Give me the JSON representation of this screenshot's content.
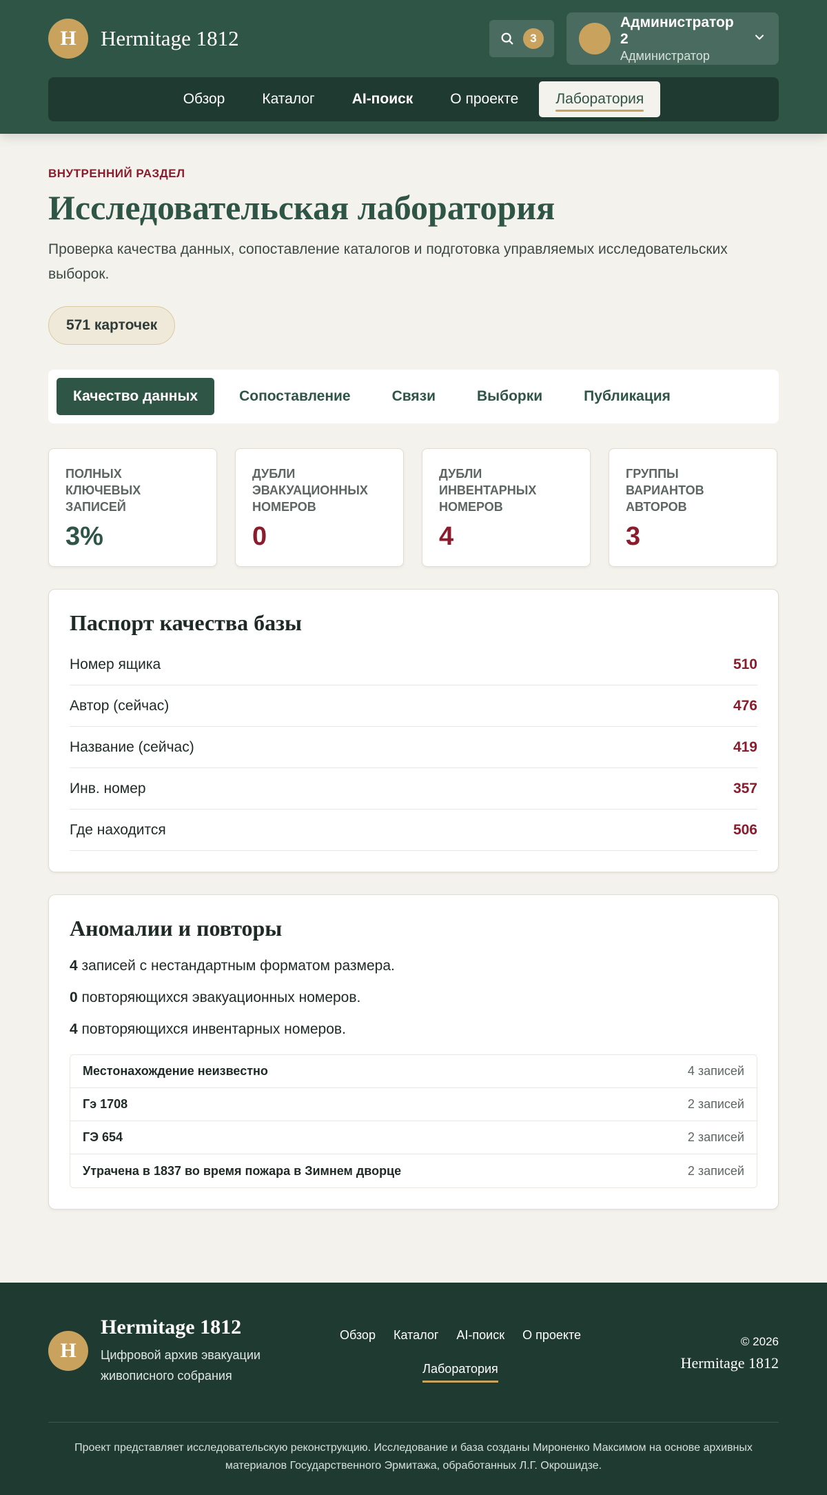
{
  "header": {
    "logo_letter": "H",
    "brand": "Hermitage 1812",
    "search_count": "3",
    "user_name": "Администратор 2",
    "user_role": "Администратор"
  },
  "nav": [
    {
      "label": "Обзор",
      "bold": false,
      "active": false
    },
    {
      "label": "Каталог",
      "bold": false,
      "active": false
    },
    {
      "label": "AI-поиск",
      "bold": true,
      "active": false
    },
    {
      "label": "О проекте",
      "bold": false,
      "active": false
    },
    {
      "label": "Лаборатория",
      "bold": false,
      "active": true
    }
  ],
  "page": {
    "eyebrow": "ВНУТРЕННИЙ РАЗДЕЛ",
    "title": "Исследовательская лаборатория",
    "description": "Проверка качества данных, сопоставление каталогов и подготовка управляемых исследовательских выборок.",
    "cards_count": "571 карточек"
  },
  "tabs": [
    {
      "label": "Качество данных",
      "active": true
    },
    {
      "label": "Сопоставление",
      "active": false
    },
    {
      "label": "Связи",
      "active": false
    },
    {
      "label": "Выборки",
      "active": false
    },
    {
      "label": "Публикация",
      "active": false
    }
  ],
  "stats": [
    {
      "label": "Полных ключевых записей",
      "value": "3%",
      "tone": "green"
    },
    {
      "label": "Дубли эвакуационных номеров",
      "value": "0",
      "tone": "red"
    },
    {
      "label": "Дубли инвентарных номеров",
      "value": "4",
      "tone": "red"
    },
    {
      "label": "Группы вариантов авторов",
      "value": "3",
      "tone": "red"
    }
  ],
  "quality": {
    "title": "Паспорт качества базы",
    "rows": [
      {
        "label": "Номер ящика",
        "value": "510"
      },
      {
        "label": "Автор (сейчас)",
        "value": "476"
      },
      {
        "label": "Название (сейчас)",
        "value": "419"
      },
      {
        "label": "Инв. номер",
        "value": "357"
      },
      {
        "label": "Где находится",
        "value": "506"
      }
    ]
  },
  "anomalies": {
    "title": "Аномалии и повторы",
    "lines": [
      {
        "num": "4",
        "text": " записей с нестандартным форматом размера."
      },
      {
        "num": "0",
        "text": " повторяющихся эвакуационных номеров."
      },
      {
        "num": "4",
        "text": " повторяющихся инвентарных номеров."
      }
    ],
    "rows": [
      {
        "name": "Местонахождение неизвестно",
        "count": "4 записей"
      },
      {
        "name": "Гэ 1708",
        "count": "2 записей"
      },
      {
        "name": "ГЭ 654",
        "count": "2 записей"
      },
      {
        "name": "Утрачена в 1837 во время пожара в Зимнем дворце",
        "count": "2 записей"
      }
    ]
  },
  "footer": {
    "logo_letter": "H",
    "brand": "Hermitage 1812",
    "tagline": "Цифровой архив эвакуации живописного собрания",
    "nav": [
      {
        "label": "Обзор",
        "active": false
      },
      {
        "label": "Каталог",
        "active": false
      },
      {
        "label": "AI-поиск",
        "active": false
      },
      {
        "label": "О проекте",
        "active": false
      },
      {
        "label": "Лаборатория",
        "active": true
      }
    ],
    "copyright": "© 2026",
    "right_name": "Hermitage 1812",
    "note": "Проект представляет исследовательскую реконструкцию. Исследование и база созданы Мироненко Максимом на основе архивных материалов Государственного Эрмитажа, обработанных Л.Г. Окрошидзе."
  },
  "colors": {
    "primary": "#2f5547",
    "dark": "#1f3a31",
    "accent": "#c9a35d",
    "danger": "#8a1c2e",
    "background": "#f4f2ec"
  },
  "icons": {
    "search": "search-icon",
    "chevron": "chevron-down-icon"
  }
}
